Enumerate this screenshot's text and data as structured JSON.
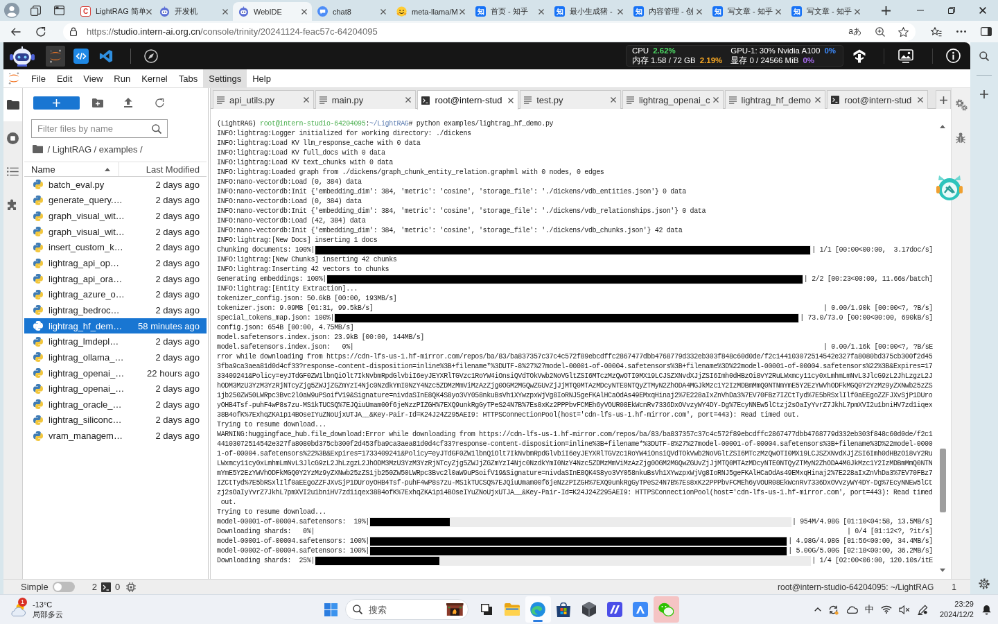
{
  "browser": {
    "tabs": [
      {
        "title": "LightRAG 简单",
        "kind": "letter",
        "favicon_text": "C",
        "selected": false
      },
      {
        "title": "开发机",
        "kind": "robot",
        "selected": false
      },
      {
        "title": "WebIDE",
        "kind": "robot",
        "selected": true
      },
      {
        "title": "chat8",
        "kind": "bubble",
        "selected": false
      },
      {
        "title": "meta-llama/M",
        "kind": "hugging",
        "selected": false
      },
      {
        "title": "首页 - 知乎",
        "kind": "zhihu",
        "favicon_text": "知",
        "selected": false
      },
      {
        "title": "最小生成猪 -",
        "kind": "zhihu",
        "favicon_text": "知",
        "selected": false
      },
      {
        "title": "内容管理 - 创",
        "kind": "zhihu",
        "favicon_text": "知",
        "selected": false
      },
      {
        "title": "写文章 - 知乎",
        "kind": "zhihu",
        "favicon_text": "知",
        "selected": false
      },
      {
        "title": "写文章 - 知乎",
        "kind": "zhihu",
        "favicon_text": "知",
        "selected": false
      }
    ],
    "address": {
      "scheme": "https://",
      "host": "studio.intern-ai.org.cn",
      "path": "/console/trinity/20241124-feac57c-64204095"
    },
    "read_aloud": "aあ"
  },
  "ide_header": {
    "launchers": [
      {
        "kind": "orbit",
        "selected": true
      },
      {
        "kind": "code-tile",
        "selected": false
      },
      {
        "kind": "ribbon",
        "selected": false
      },
      {
        "kind": "compass",
        "selected": false
      }
    ],
    "metrics": [
      {
        "label": "CPU",
        "value": "2.62%",
        "color": "#4cd964"
      },
      {
        "label": "GPU-1: 30% Nvidia A100",
        "value": "0%",
        "color": "#3d8bfd"
      },
      {
        "label": "内存 1.58 / 72 GB",
        "value": "2.19%",
        "color": "#f5a623"
      },
      {
        "label": "显存 0 / 24566 MiB",
        "value": "0%",
        "color": "#a86cf0"
      }
    ]
  },
  "menu": [
    {
      "label": "File",
      "highlighted": false
    },
    {
      "label": "Edit",
      "highlighted": false
    },
    {
      "label": "View",
      "highlighted": false
    },
    {
      "label": "Run",
      "highlighted": false
    },
    {
      "label": "Kernel",
      "highlighted": false
    },
    {
      "label": "Tabs",
      "highlighted": false
    },
    {
      "label": "Settings",
      "highlighted": true
    },
    {
      "label": "Help",
      "highlighted": false
    }
  ],
  "activity_bar": [
    {
      "kind": "folder",
      "selected": true
    },
    {
      "kind": "stop",
      "selected": false
    },
    {
      "kind": "list",
      "selected": false
    },
    {
      "kind": "puzzle",
      "selected": false
    }
  ],
  "file_browser": {
    "filter": {
      "placeholder": "Filter files by name"
    },
    "breadcrumb": "/ LightRAG / examples /",
    "columns": [
      {
        "label": "Name",
        "sorted": true
      },
      {
        "label": "Last Modified",
        "sorted": false
      }
    ],
    "rows": [
      {
        "name": "batch_eval.py",
        "modified": "2 days ago",
        "selected": false
      },
      {
        "name": "generate_query.…",
        "modified": "2 days ago",
        "selected": false
      },
      {
        "name": "graph_visual_wit…",
        "modified": "2 days ago",
        "selected": false
      },
      {
        "name": "graph_visual_wit…",
        "modified": "2 days ago",
        "selected": false
      },
      {
        "name": "insert_custom_k…",
        "modified": "2 days ago",
        "selected": false
      },
      {
        "name": "lightrag_api_op…",
        "modified": "2 days ago",
        "selected": false
      },
      {
        "name": "lightrag_api_ora…",
        "modified": "2 days ago",
        "selected": false
      },
      {
        "name": "lightrag_azure_o…",
        "modified": "2 days ago",
        "selected": false
      },
      {
        "name": "lightrag_bedroc…",
        "modified": "2 days ago",
        "selected": false
      },
      {
        "name": "lightrag_hf_dem…",
        "modified": "58 minutes ago",
        "selected": true
      },
      {
        "name": "lightrag_lmdepl…",
        "modified": "2 days ago",
        "selected": false
      },
      {
        "name": "lightrag_ollama_…",
        "modified": "2 days ago",
        "selected": false
      },
      {
        "name": "lightrag_openai_…",
        "modified": "22 hours ago",
        "selected": false
      },
      {
        "name": "lightrag_openai_…",
        "modified": "2 days ago",
        "selected": false
      },
      {
        "name": "lightrag_oracle_…",
        "modified": "2 days ago",
        "selected": false
      },
      {
        "name": "lightrag_siliconc…",
        "modified": "2 days ago",
        "selected": false
      },
      {
        "name": "vram_managem…",
        "modified": "2 days ago",
        "selected": false
      }
    ]
  },
  "editor_tabs": [
    {
      "kind": "file",
      "label": "api_utils.py",
      "selected": false
    },
    {
      "kind": "file",
      "label": "main.py",
      "selected": false
    },
    {
      "kind": "terminal",
      "label": "root@intern-stud",
      "selected": true
    },
    {
      "kind": "file",
      "label": "test.py",
      "selected": false
    },
    {
      "kind": "file",
      "label": "lightrag_openai_c",
      "selected": false
    },
    {
      "kind": "file",
      "label": "lightrag_hf_demo",
      "selected": false
    },
    {
      "kind": "terminal",
      "label": "root@intern-stud",
      "selected": false
    }
  ],
  "terminal": {
    "lines": [
      {
        "kind": "prompt",
        "parts": [
          {
            "kind": "plain",
            "text": "(LightRAG) "
          },
          {
            "kind": "user",
            "text": "root@intern-studio-64204095"
          },
          {
            "kind": "plain",
            "text": ":"
          },
          {
            "kind": "path",
            "text": "~/LightRAG"
          },
          {
            "kind": "plain",
            "text": "# python examples/lightrag_hf_demo.py"
          }
        ]
      },
      {
        "kind": "text",
        "text": "INFO:lightrag:Logger initialized for working directory: ./dickens"
      },
      {
        "kind": "text",
        "text": "INFO:lightrag:Load KV llm_response_cache with 0 data"
      },
      {
        "kind": "text",
        "text": "INFO:lightrag:Load KV full_docs with 0 data"
      },
      {
        "kind": "text",
        "text": "INFO:lightrag:Load KV text_chunks with 0 data"
      },
      {
        "kind": "text",
        "text": "INFO:lightrag:Loaded graph from ./dickens/graph_chunk_entity_relation.graphml with 0 nodes, 0 edges"
      },
      {
        "kind": "text",
        "text": "INFO:nano-vectordb:Load (0, 384) data"
      },
      {
        "kind": "text",
        "text": "INFO:nano-vectordb:Init {'embedding_dim': 384, 'metric': 'cosine', 'storage_file': './dickens/vdb_entities.json'} 0 data"
      },
      {
        "kind": "text",
        "text": "INFO:nano-vectordb:Load (0, 384) data"
      },
      {
        "kind": "text",
        "text": "INFO:nano-vectordb:Init {'embedding_dim': 384, 'metric': 'cosine', 'storage_file': './dickens/vdb_relationships.json'} 0 data"
      },
      {
        "kind": "text",
        "text": "INFO:nano-vectordb:Load (42, 384) data"
      },
      {
        "kind": "text",
        "text": "INFO:nano-vectordb:Init {'embedding_dim': 384, 'metric': 'cosine', 'storage_file': './dickens/vdb_chunks.json'} 42 data"
      },
      {
        "kind": "text",
        "text": "INFO:lightrag:[New Docs] inserting 1 docs"
      },
      {
        "kind": "progress",
        "label": "Chunking documents: 100%|",
        "level": 1,
        "stats": "| 1/1 [00:00<00:00,  3.17doc/s]"
      },
      {
        "kind": "text",
        "text": "INFO:lightrag:[New Chunks] inserting 42 chunks"
      },
      {
        "kind": "text",
        "text": "INFO:lightrag:Inserting 42 vectors to chunks"
      },
      {
        "kind": "progress",
        "label": "Generating embeddings: 100%|",
        "level": 1,
        "stats": "| 2/2 [00:23<00:00, 11.66s/batch]"
      },
      {
        "kind": "text",
        "text": "INFO:lightrag:[Entity Extraction]..."
      },
      {
        "kind": "text",
        "text": "tokenizer_config.json: 50.6kB [00:00, 193MB/s]"
      },
      {
        "kind": "split",
        "text": "tokenizer.json: 9.09MB [01:31, 99.5kB/s]",
        "right": "| 0.00/1.90k [00:00<?, ?B/s]"
      },
      {
        "kind": "progress",
        "label": "special_tokens_map.json: 100%|",
        "level": 1,
        "stats": "| 73.0/73.0 [00:00<00:00, 690kB/s]"
      },
      {
        "kind": "text",
        "text": "config.json: 654B [00:00, 4.75MB/s]"
      },
      {
        "kind": "text",
        "text": "model.safetensors.index.json: 23.9kB [00:00, 144MB/s]"
      },
      {
        "kind": "split",
        "text": "model.safetensors.index.json:   0%|",
        "right": "| 0.00/1.16k [00:00<?, ?B/sE"
      },
      {
        "kind": "text",
        "text": "rror while downloading from https://cdn-lfs-us-1.hf-mirror.com/repos/ba/83/ba837357c37c4c572f89ebcdffc2867477dbb4768779d332eb303f848c60d0de/f2c144103072514542e327fa8080bd375cb300f2d45"
      },
      {
        "kind": "text",
        "text": "3fba9ca3aea81d0d4cf33?response-content-disposition=inline%3B+filename*%3DUTF-8%27%27model-00001-of-00004.safetensors%3B+filename%3D%22model-00001-of-00004.safetensors%22%3B&Expires=17"
      },
      {
        "kind": "text",
        "text": "33409241&Policy=eyJTdGF0ZW1lbnQiOlt7IkNvbmRpdGlvbiI6eyJEYXRlTGVzc1RoYW4iOnsiQVdTOkVwb2NoVGltZSI6MTczMzQwOTI0MX19LCJSZXNvdXJjZSI6Imh0dHBzOi8vY2RuLWxmcy11cy0xLmhmLmNvL3JlcG9zL2JhLzgzL2J"
      },
      {
        "kind": "text",
        "text": "hODM3MzU3YzM3YzRjNTcyZjg5ZWJjZGZmYzI4Njc0NzdkYmI0NzY4Nzc5ZDMzMmViMzAzZjg0OGM2MGQwZGUvZjJjMTQ0MTAzMDcyNTE0NTQyZTMyN2ZhODA4MGJkMzc1Y2IzMDBmMmQ0NTNmYmE5Y2EzYWVhODFkMGQ0Y2YzMz9yZXNwb25zZS"
      },
      {
        "kind": "text",
        "text": "1jb250ZW50LWRpc3Bvc2l0aW9uPSoifV19&Signature=nivdaSInE8QK4S8yo3VY058nkuBsVh1XYwzpxWjVg8IoRNJ5geFKAlHCaOdAs49EMxqHinaj2%7E228aIxZnVhDa3%7EV70FBz7IZCtTyd%7E5bRSxlIlf0aEEgoZZFJXvSjP1DUro"
      },
      {
        "kind": "text",
        "text": "yOHB4Tsf-puhF4wP8s7zu-MS1kTUCSQ%7EJQiuUmam00f6jeNzzPIZGH%7EXQ9unkRgGyTPeS24N7B%7Es8xKz2PPPbvFCMEh6yVOUR08EkWcnRv7336DxOVvzyWY4DY-Dg%7EcyNNEw5lCtzj2sOaIyYvrZ7JkhL7pmXVI2u1bniHV7zd1iqex"
      },
      {
        "kind": "text",
        "text": "38B4ofK%7ExhqZKA1p14BOseIYuZNoUjxUTJA__&Key-Pair-Id=K24J24Z295AEI9: HTTPSConnectionPool(host='cdn-lfs-us-1.hf-mirror.com', port=443): Read timed out."
      },
      {
        "kind": "text",
        "text": "Trying to resume download..."
      },
      {
        "kind": "text",
        "text": "WARNING:huggingface_hub.file_download:Error while downloading from https://cdn-lfs-us-1.hf-mirror.com/repos/ba/83/ba837357c37c4c572f89ebcdffc2867477dbb4768779d332eb303f848c60d0de/f2c1"
      },
      {
        "kind": "text",
        "text": "44103072514542e327fa8080bd375cb300f2d453fba9ca3aea81d0d4cf33?response-content-disposition=inline%3B+filename*%3DUTF-8%27%27model-00001-of-00004.safetensors%3B+filename%3D%22model-0000"
      },
      {
        "kind": "text",
        "text": "1-of-00004.safetensors%22%3B&Expires=1733409241&Policy=eyJTdGF0ZW1lbnQiOlt7IkNvbmRpdGlvbiI6eyJEYXRlTGVzc1RoYW4iOnsiQVdTOkVwb2NoVGltZSI6MTczMzQwOTI0MX19LCJSZXNvdXJjZSI6Imh0dHBzOi8vY2Ru"
      },
      {
        "kind": "text",
        "text": "LWxmcy11cy0xLmhmLmNvL3JlcG9zL2JhLzgzL2JhODM3MzU3YzM3YzRjNTcyZjg5ZWJjZGZmYzI4Njc0NzdkYmI0NzY4Nzc5ZDMzMmViMzAzZjg0OGM2MGQwZGUvZjJjMTQ0MTAzMDcyNTE0NTQyZTMyN2ZhODA4MGJkMzc1Y2IzMDBmMmQ0NTN"
      },
      {
        "kind": "text",
        "text": "mYmE5Y2EzYWVhODFkMGQ0Y2YzMz9yZXNwb25zZS1jb250ZW50LWRpc3Bvc2l0aW9uPSoifV19&Signature=nivdaSInE8QK4S8yo3VY058nkuBsVh1XYwzpxWjVg8IoRNJ5geFKAlHCaOdAs49EMxqHinaj2%7E228aIxZnVhDa3%7EV70FBz7"
      },
      {
        "kind": "text",
        "text": "IZCtTyd%7E5bRSxlIlf0aEEgoZZFJXvSjP1DUroyOHB4Tsf-puhF4wP8s7zu-MS1kTUCSQ%7EJQiuUmam00f6jeNzzPIZGH%7EXQ9unkRgGyTPeS24N7B%7Es8xKz2PPPbvFCMEh6yVOUR08EkWcnRv7336DxOVvzyWY4DY-Dg%7EcyNNEw5lCt"
      },
      {
        "kind": "text",
        "text": "zj2sOaIyYvrZ7JkhL7pmXVI2u1bniHV7zd1iqex38B4ofK%7ExhqZKA1p14BOseIYuZNoUjxUTJA__&Key-Pair-Id=K24J24Z295AEI9: HTTPSConnectionPool(host='cdn-lfs-us-1.hf-mirror.com', port=443): Read timed"
      },
      {
        "kind": "text",
        "text": " out."
      },
      {
        "kind": "text",
        "text": "Trying to resume download..."
      },
      {
        "kind": "progress",
        "label": "model-00001-of-00004.safetensors:  19%|",
        "level": 0.19,
        "stats": "| 954M/4.98G [01:10<04:58, 13.5MB/s]"
      },
      {
        "kind": "split",
        "text": "Downloading shards:   0%|",
        "right": "| 0/4 [01:12<?, ?it/s]"
      },
      {
        "kind": "progress",
        "label": "model-00001-of-00004.safetensors: 100%|",
        "level": 1,
        "stats": "| 4.98G/4.98G [01:56<00:00, 34.4MB/s]"
      },
      {
        "kind": "progress",
        "label": "model-00002-of-00004.safetensors: 100%|",
        "level": 1,
        "stats": "| 5.00G/5.00G [02:18<00:00, 36.2MB/s]"
      },
      {
        "kind": "progress",
        "label": "Downloading shards:  25%|",
        "level": 0.25,
        "stats": "| 1/4 [02:00<06:00, 120.10s/itE"
      }
    ]
  },
  "status_bar": {
    "mode": {
      "label": "Simple",
      "on": false
    },
    "terminals": "2",
    "kernels": "0",
    "terminal_path": "root@intern-studio-64204095: ~/LightRAG",
    "trailing_text": "1"
  },
  "taskbar": {
    "weather": {
      "badge": "1",
      "temperature": "-13°C",
      "condition": "局部多云"
    },
    "search": {
      "placeholder": "搜索"
    },
    "apps": [
      {
        "kind": "task-view",
        "focused": false,
        "flashing": false
      },
      {
        "kind": "explorer",
        "focused": false,
        "flashing": false
      },
      {
        "kind": "browser",
        "focused": true,
        "flashing": false
      },
      {
        "kind": "store",
        "focused": false,
        "flashing": false
      },
      {
        "kind": "cube",
        "focused": false,
        "flashing": false
      },
      {
        "kind": "stripes",
        "focused": false,
        "flashing": false
      },
      {
        "kind": "arch",
        "focused": false,
        "flashing": false
      },
      {
        "kind": "chat",
        "focused": false,
        "flashing": true
      }
    ],
    "tray": {
      "input_method": "中",
      "time": "23:29",
      "date": "2024/12/2"
    }
  }
}
